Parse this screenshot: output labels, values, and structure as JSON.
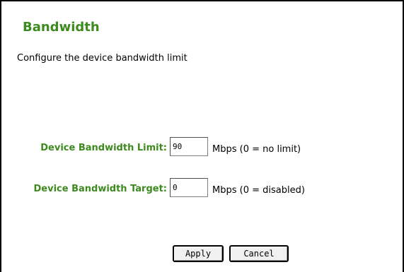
{
  "page": {
    "title": "Bandwidth",
    "description": "Configure the device bandwidth limit"
  },
  "form": {
    "limit": {
      "label": "Device Bandwidth Limit:",
      "value": "90",
      "unit": "Mbps (0 = no limit)"
    },
    "target": {
      "label": "Device Bandwidth Target:",
      "value": "0",
      "unit": "Mbps (0 = disabled)"
    }
  },
  "actions": {
    "apply_label": "Apply",
    "cancel_label": "Cancel"
  },
  "colors": {
    "accent": "#3d8a1e"
  }
}
